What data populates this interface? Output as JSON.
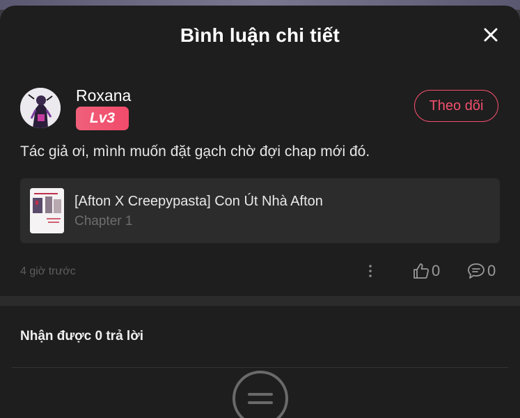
{
  "header": {
    "title": "Bình luận chi tiết"
  },
  "comment": {
    "author": {
      "name": "Roxana",
      "level": "Lv3"
    },
    "follow_label": "Theo dõi",
    "text": "Tác giả ơi, mình muốn đặt gạch chờ đợi chap mới đó.",
    "story": {
      "title": "[Afton X Creepypasta] Con Út Nhà Afton",
      "chapter": "Chapter 1"
    },
    "timestamp": "4 giờ trước",
    "likes": "0",
    "replies": "0"
  },
  "replies_section": {
    "label": "Nhận được 0 trả lời"
  },
  "icons": {
    "close": "close-icon",
    "more": "more-vertical-icon",
    "like": "thumbs-up-icon",
    "reply": "comment-bubble-icon",
    "empty": "empty-list-icon"
  },
  "colors": {
    "accent": "#f2506d",
    "background": "#1e1e1e",
    "card": "#2c2c2c"
  }
}
